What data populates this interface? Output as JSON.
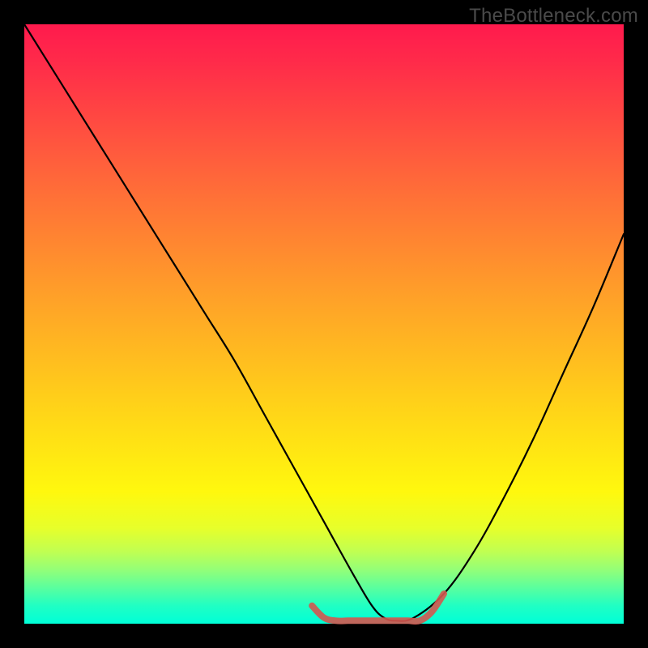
{
  "watermark": "TheBottleneck.com",
  "chart_data": {
    "type": "line",
    "title": "",
    "xlabel": "",
    "ylabel": "",
    "xlim": [
      0,
      100
    ],
    "ylim": [
      0,
      100
    ],
    "background_gradient": {
      "top": "#ff1a4d",
      "middle": "#ffe314",
      "bottom": "#00ffd8"
    },
    "series": [
      {
        "name": "primary-curve",
        "color": "#000000",
        "x": [
          0,
          5,
          10,
          15,
          20,
          25,
          30,
          35,
          40,
          45,
          50,
          55,
          58,
          60,
          62,
          65,
          70,
          75,
          80,
          85,
          90,
          95,
          100
        ],
        "values": [
          100,
          92,
          84,
          76,
          68,
          60,
          52,
          44,
          35,
          26,
          17,
          8,
          3,
          1,
          0.5,
          1,
          5,
          12,
          21,
          31,
          42,
          53,
          65
        ]
      },
      {
        "name": "lower-overlay",
        "color": "#d4574f",
        "x": [
          48,
          50,
          52,
          54,
          56,
          58,
          60,
          62,
          64,
          66,
          68,
          70
        ],
        "values": [
          3,
          1,
          0.5,
          0.5,
          0.5,
          0.5,
          0.5,
          0.5,
          0.5,
          0.5,
          2,
          5
        ]
      }
    ]
  }
}
